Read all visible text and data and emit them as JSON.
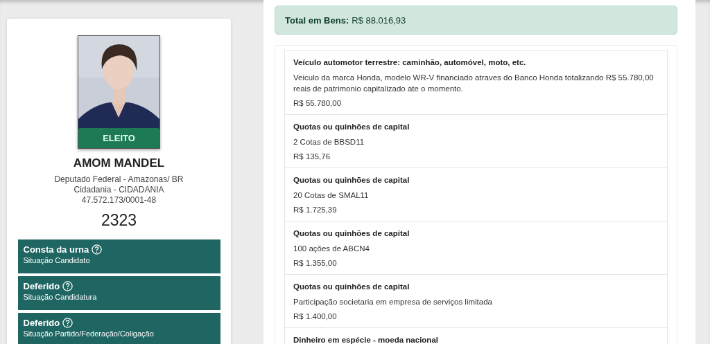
{
  "candidate": {
    "status_badge": "ELEITO",
    "name": "AMOM MANDEL",
    "details": [
      "Deputado Federal - Amazonas/ BR",
      "Cidadania - CIDADANIA",
      "47.572.173/0001-48"
    ],
    "number": "2323"
  },
  "situations": [
    {
      "value": "Consta da urna",
      "label": "Situação Candidato"
    },
    {
      "value": "Deferido",
      "label": "Situação Candidatura"
    },
    {
      "value": "Deferido",
      "label": "Situação Partido/Federação/Coligação"
    }
  ],
  "total": {
    "label": "Total em Bens:",
    "value": "R$ 88.016,93"
  },
  "assets": [
    {
      "type": "Veículo automotor terrestre: caminhão, automóvel, moto, etc.",
      "description": "Veiculo da marca Honda, modelo WR-V financiado atraves do Banco Honda totalizando R$ 55.780,00 reais de patrimonio capitalizado ate o momento.",
      "value": "R$ 55.780,00"
    },
    {
      "type": "Quotas ou quinhões de capital",
      "description": "2 Cotas de BBSD11",
      "value": "R$ 135,76"
    },
    {
      "type": "Quotas ou quinhões de capital",
      "description": "20 Cotas de SMAL11",
      "value": "R$ 1.725,39"
    },
    {
      "type": "Quotas ou quinhões de capital",
      "description": "100 ações de ABCN4",
      "value": "R$ 1.355,00"
    },
    {
      "type": "Quotas ou quinhões de capital",
      "description": "Participação societaria em empresa de serviços limitada",
      "value": "R$ 1.400,00"
    },
    {
      "type": "Dinheiro em espécie - moeda nacional"
    }
  ]
}
